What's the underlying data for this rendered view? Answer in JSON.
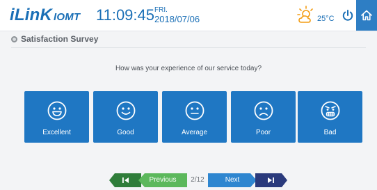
{
  "header": {
    "logo_brand": "iLinK",
    "logo_suffix": "IOMT",
    "time": "11:09:45",
    "day": "FRI.",
    "date": "2018/07/06",
    "weather_icon": "partly-sunny-icon",
    "temperature": "25°C",
    "power_icon": "power-icon",
    "home_icon": "home-icon"
  },
  "section": {
    "title": "Satisfaction Survey"
  },
  "survey": {
    "question": "How was your experience of our service today?",
    "options": [
      {
        "label": "Excellent",
        "icon": "grin-face-icon"
      },
      {
        "label": "Good",
        "icon": "smile-face-icon"
      },
      {
        "label": "Average",
        "icon": "neutral-face-icon"
      },
      {
        "label": "Poor",
        "icon": "sad-face-icon"
      },
      {
        "label": "Bad",
        "icon": "angry-face-icon"
      }
    ]
  },
  "pager": {
    "first_icon": "skip-first-icon",
    "previous_label": "Previous",
    "counter": "2/12",
    "next_label": "Next",
    "last_icon": "skip-last-icon"
  },
  "colors": {
    "brand_blue": "#1a6fb6",
    "card_blue": "#1f77c3",
    "pager_green": "#5cb85c",
    "pager_green_dark": "#2f7d3a",
    "pager_blue": "#2e86d0",
    "pager_navy": "#2a3a7c",
    "sun_orange": "#f39c12"
  }
}
